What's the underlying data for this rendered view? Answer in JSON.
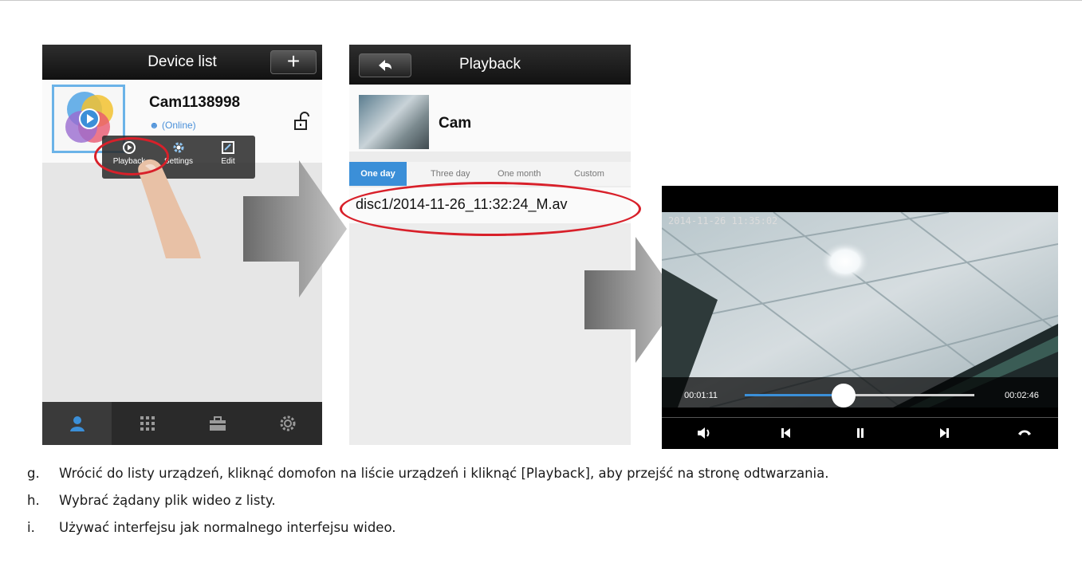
{
  "screen1": {
    "title": "Device list",
    "add_label": "+",
    "device": {
      "name": "Cam1138998",
      "status": "(Online)"
    },
    "popup": [
      {
        "label": "Playback",
        "icon": "play-circle-icon"
      },
      {
        "label": "Settings",
        "icon": "gear-icon"
      },
      {
        "label": "Edit",
        "icon": "edit-icon"
      }
    ],
    "tabs": [
      {
        "icon": "person-icon",
        "active": true
      },
      {
        "icon": "grid-icon",
        "active": false
      },
      {
        "icon": "toolbox-icon",
        "active": false
      },
      {
        "icon": "gear-icon",
        "active": false
      }
    ],
    "accent": "#3b8fd8"
  },
  "screen2": {
    "title": "Playback",
    "camera_name": "Cam",
    "tabs": [
      "One day",
      "Three day",
      "One month",
      "Custom"
    ],
    "active_tab": "One day",
    "files": [
      "disc1/2014-11-26_11:32:24_M.av"
    ]
  },
  "screen3": {
    "timestamp": "2014-11-26 11:35:02",
    "elapsed": "00:01:11",
    "duration": "00:02:46",
    "progress_fraction": 0.43,
    "controls": [
      "volume-icon",
      "previous-icon",
      "pause-icon",
      "next-icon",
      "hangup-icon"
    ]
  },
  "highlight_color": "#d8202a",
  "instructions": [
    {
      "marker": "g.",
      "text": "Wrócić do listy urządzeń, kliknąć domofon na liście urządzeń i kliknąć [Playback], aby przejść na stronę odtwarzania."
    },
    {
      "marker": "h.",
      "text": "Wybrać żądany plik wideo z listy."
    },
    {
      "marker": "i.",
      "text": "Używać interfejsu jak normalnego interfejsu wideo."
    }
  ]
}
